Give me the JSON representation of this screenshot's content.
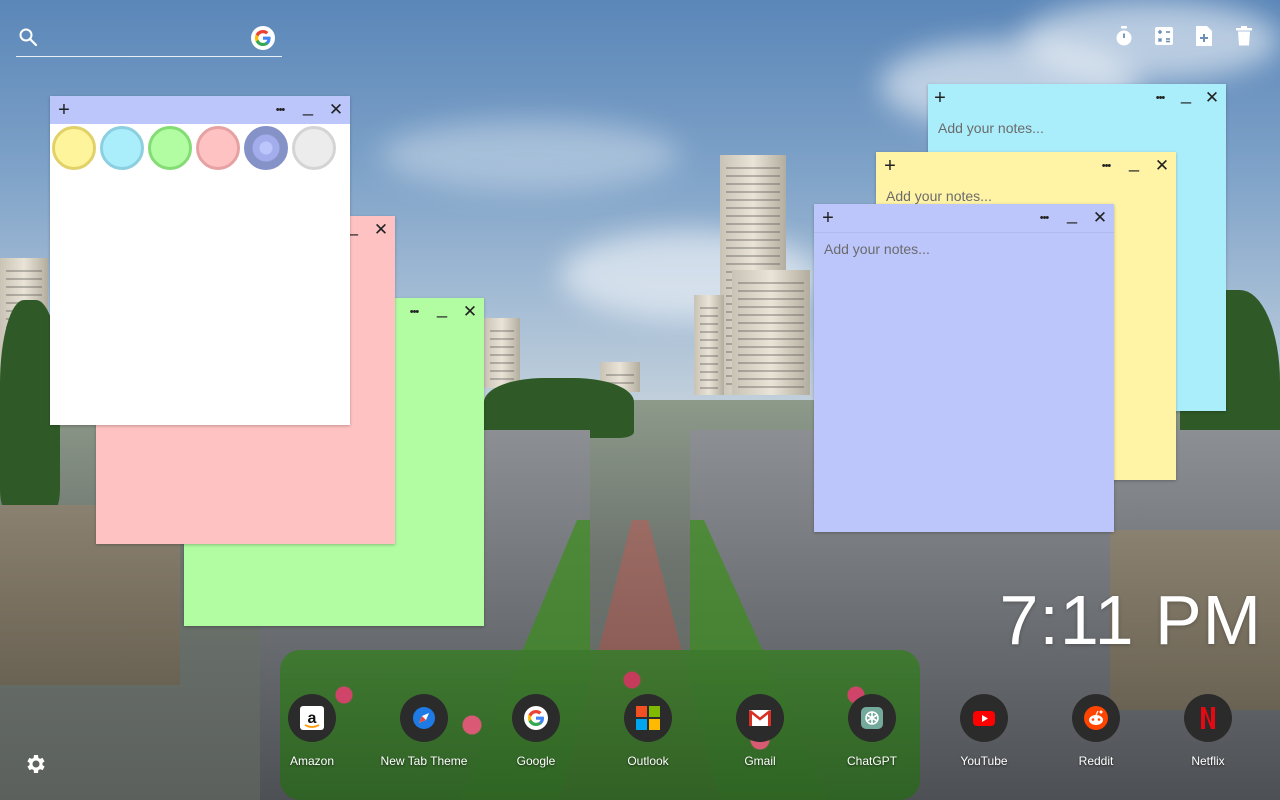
{
  "search": {
    "value": "",
    "placeholder": ""
  },
  "toolbar": {
    "icons": [
      "timer-icon",
      "calculator-icon",
      "add-note-icon",
      "trash-icon"
    ]
  },
  "notes": [
    {
      "id": "blue-note",
      "color": "#bcc6fb",
      "placeholder": "Add your notes..."
    },
    {
      "id": "yellow-note",
      "color": "#fff3a6",
      "placeholder": "Add your notes..."
    },
    {
      "id": "cyan-note",
      "color": "#abeefb",
      "placeholder": "Add your notes..."
    },
    {
      "id": "white-note",
      "color": "#ffffff",
      "placeholder": ""
    },
    {
      "id": "pink-note",
      "color": "#ffc2c2",
      "placeholder": ""
    },
    {
      "id": "green-note",
      "color": "#b2fca2",
      "placeholder": ""
    }
  ],
  "note_controls": {
    "add": "+",
    "more": "•••",
    "minimize": "_",
    "close": "✕"
  },
  "palette": [
    {
      "name": "yellow",
      "fill": "#fdf49b",
      "ring": "#e1d168"
    },
    {
      "name": "cyan",
      "fill": "#abeefb",
      "ring": "#8ccfe0"
    },
    {
      "name": "green",
      "fill": "#b2fca2",
      "ring": "#83dc74"
    },
    {
      "name": "pink",
      "fill": "#ffc2c2",
      "ring": "#e6a2a2"
    },
    {
      "name": "blue",
      "fill": "#bcc6fb",
      "ring": "#8592c8"
    },
    {
      "name": "white",
      "fill": "#ececec",
      "ring": "#d4d4d4"
    }
  ],
  "clock": {
    "time": "7:11 PM"
  },
  "shortcuts": [
    {
      "label": "Amazon",
      "icon": "amazon-icon"
    },
    {
      "label": "New Tab Theme",
      "icon": "new-tab-theme-icon"
    },
    {
      "label": "Google",
      "icon": "google-icon"
    },
    {
      "label": "Outlook",
      "icon": "outlook-icon"
    },
    {
      "label": "Gmail",
      "icon": "gmail-icon"
    },
    {
      "label": "ChatGPT",
      "icon": "chatgpt-icon"
    },
    {
      "label": "YouTube",
      "icon": "youtube-icon"
    },
    {
      "label": "Reddit",
      "icon": "reddit-icon"
    },
    {
      "label": "Netflix",
      "icon": "netflix-icon"
    }
  ]
}
